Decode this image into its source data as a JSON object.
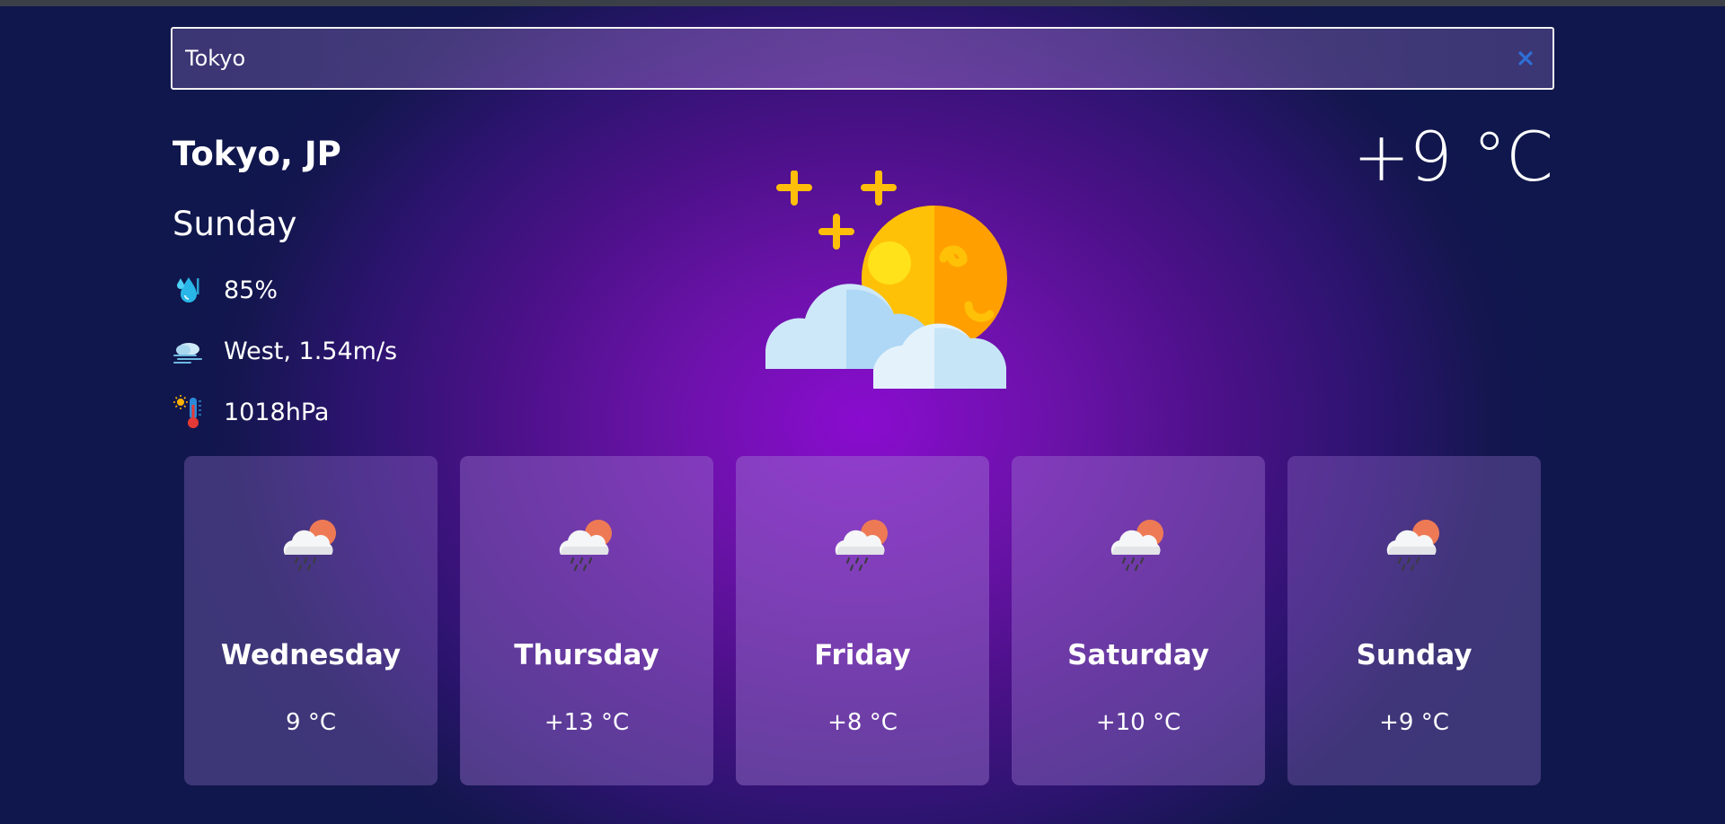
{
  "search": {
    "value": "Tokyo",
    "clear_icon": "close-icon"
  },
  "current": {
    "location": "Tokyo, JP",
    "day": "Sunday",
    "temperature": "+9 °C",
    "humidity": "85%",
    "wind": "West, 1.54m/s",
    "pressure": "1018hPa",
    "icon": "moon-stars-clouds-icon"
  },
  "forecast": [
    {
      "day": "Wednesday",
      "temp": "9 °C",
      "icon": "rain-cloud-sun-icon"
    },
    {
      "day": "Thursday",
      "temp": "+13 °C",
      "icon": "rain-cloud-sun-icon"
    },
    {
      "day": "Friday",
      "temp": "+8 °C",
      "icon": "rain-cloud-sun-icon"
    },
    {
      "day": "Saturday",
      "temp": "+10 °C",
      "icon": "rain-cloud-sun-icon"
    },
    {
      "day": "Sunday",
      "temp": "+9 °C",
      "icon": "rain-cloud-sun-icon"
    }
  ],
  "colors": {
    "accent": "#8a0ccf",
    "background_edge": "#0f174c",
    "clear_button": "#2f6fd6"
  }
}
